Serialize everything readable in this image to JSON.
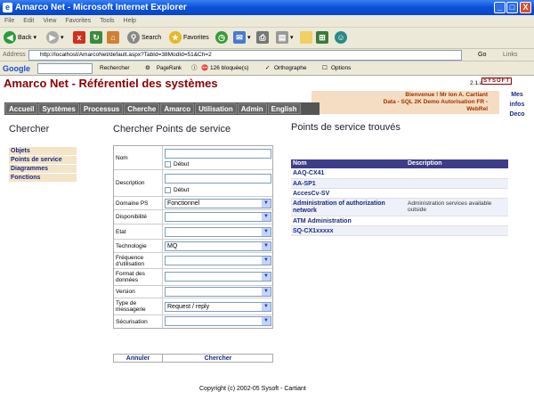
{
  "window": {
    "title": "Amarco Net - Microsoft Internet Explorer",
    "min": "_",
    "max": "□",
    "close": "X"
  },
  "menu": [
    "File",
    "Edit",
    "View",
    "Favorites",
    "Tools",
    "Help"
  ],
  "toolbar": {
    "back": "Back",
    "search": "Search",
    "favorites": "Favorites"
  },
  "address": {
    "label": "Address",
    "url": "http://localhost/AmarcoNet/default.aspx?TabId=38ModId=51&Ch=2",
    "go": "Go",
    "links": "Links"
  },
  "googlebar": {
    "logo": "Google",
    "search": "Rechercher",
    "pagerank": "PageRank",
    "blocked": "126 bloquée(s)",
    "spell": "Orthographe",
    "options": "Options"
  },
  "header": {
    "brand": "Amarco Net - Référentiel des systèmes",
    "version": "2.1.a",
    "sysoft": "SYSOFT",
    "welcome1": "Bienvenue ! Mr Ion A. Cartiant",
    "welcome2": "Data - SQL 2K Demo Autorisation FR -",
    "welcome3": "WebRel"
  },
  "nav": [
    "Accueil",
    "Systèmes",
    "Processus",
    "Cherche",
    "Amarco",
    "Utilisation",
    "Admin",
    "English"
  ],
  "rightlinks": [
    "Mes",
    "infos",
    "Deco"
  ],
  "left": {
    "title": "Chercher",
    "items": [
      "Objets",
      "Points de service",
      "Diagrammes",
      "Fonctions"
    ]
  },
  "form": {
    "title": "Chercher Points de service",
    "fields": {
      "nom": "Nom",
      "debut": "Début",
      "description": "Description",
      "debut2": "Début",
      "domaine": "Domaine PS",
      "domaine_val": "Fonctionnel",
      "disponibilite": "Disponibilité",
      "etat": "Etat",
      "technologie": "Technologie",
      "technologie_val": "MQ",
      "frequence": "Fréquence d'utilisation",
      "format": "Format des données",
      "version": "Version",
      "type": "Type de messagerie",
      "type_val": "Request / reply",
      "securisation": "Sécurisation"
    },
    "cancel": "Annuler",
    "search": "Chercher"
  },
  "results": {
    "title": "Points de service trouvés",
    "col_name": "Nom",
    "col_desc": "Description",
    "rows": [
      {
        "name": "AAQ-CX41",
        "desc": ""
      },
      {
        "name": "AA-SP1",
        "desc": ""
      },
      {
        "name": "AccesCv-SV",
        "desc": ""
      },
      {
        "name": "Administration of authorization network",
        "desc": "Administration services available outside"
      },
      {
        "name": "ATM Administration",
        "desc": ""
      },
      {
        "name": "SQ-CX1xxxxx",
        "desc": ""
      }
    ]
  },
  "footer": {
    "copyright": "Copyright (c) 2002-05 Sysoft - Cartiant"
  }
}
